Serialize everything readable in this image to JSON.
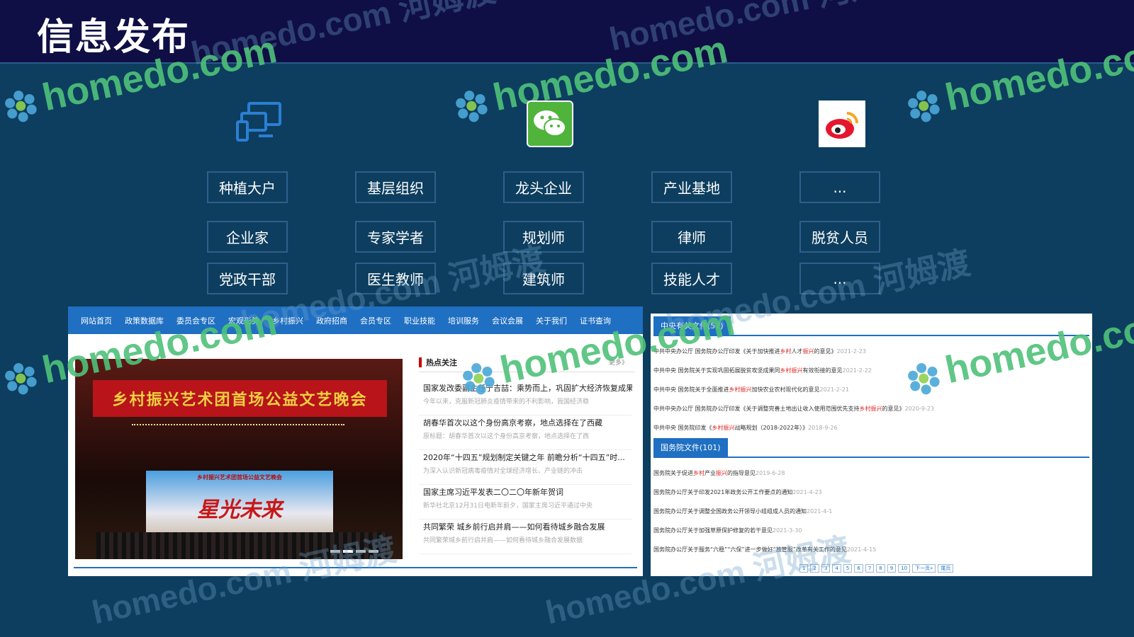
{
  "page_title": "信息发布",
  "watermark": {
    "brand": "homedo.com",
    "cn": "河姆渡"
  },
  "channels": [
    {
      "icon": "devices-icon"
    },
    {
      "icon": "wechat-icon"
    },
    {
      "icon": "weibo-icon"
    }
  ],
  "groups": [
    [
      "种植大户",
      "基层组织",
      "龙头企业",
      "产业基地",
      "..."
    ],
    [
      "企业家",
      "专家学者",
      "规划师",
      "律师",
      "脱贫人员"
    ],
    [
      "党政干部",
      "医生教师",
      "建筑师",
      "技能人才",
      "..."
    ]
  ],
  "left_site": {
    "nav": [
      "网站首页",
      "政策数据库",
      "委员会专区",
      "宏观形势",
      "乡村振兴",
      "政府招商",
      "会员专区",
      "职业技能",
      "培训服务",
      "会议会展",
      "关于我们",
      "证书查询"
    ],
    "banner_text": "乡村振兴艺术团首场公益文艺晚会",
    "screen_title": "乡村振兴艺术团首场公益文艺晚会",
    "screen_art": "星光未来",
    "hot_label": "热点关注",
    "hot_more": "更多》",
    "hot_items": [
      {
        "title": "国家发改委副主任宁吉喆：乘势而上，巩固扩大经济恢复成果",
        "summary": "今年以来，克服新冠肺炎疫情带来的不利影响，我国经济稳"
      },
      {
        "title": "胡春华首次以这个身份高京考察，地点选择在了西藏",
        "summary": "原标题：胡春华首次以这个身份高京考察，地点选择在了西"
      },
      {
        "title": "2020年“十四五”规划制定关键之年 前瞻分析“十四五”时...",
        "summary": "为深入认识新冠病毒疫情对全球经济增长、产业链的冲击"
      },
      {
        "title": "国家主席习近平发表二〇二〇年新年贺词",
        "summary": "新华社北京12月31日电新年前夕，国家主席习近平通过中央"
      },
      {
        "title": "共同繁荣 城乡前行启并肩——如何看待城乡融合发展",
        "summary": "共同繁荣城乡前行启并肩——如何看待城乡融合发展数据"
      }
    ]
  },
  "right_site": {
    "tab1": "中央有关文件(57)",
    "central_docs": [
      {
        "a": "中共中央办公厅 国务院办公厅印发《关于加快推进",
        "hl": "乡村",
        "b": "人才",
        "hl2": "振兴",
        "c": "的意见》",
        "date": "2021-2-23"
      },
      {
        "a": "中共中央 国务院关于实现巩固拓展脱贫攻坚成果同",
        "hl": "乡村振兴",
        "b": "有效衔接的意见",
        "hl2": "",
        "c": "",
        "date": "2021-2-22"
      },
      {
        "a": "中共中央 国务院关于全面推进",
        "hl": "乡村振兴",
        "b": "加快农业农村现代化的意见",
        "hl2": "",
        "c": "",
        "date": "2021-2-21"
      },
      {
        "a": "中共中央办公厅 国务院办公厅印发《关于调整完善土地出让收入使用范围优先支持",
        "hl": "乡村振兴",
        "b": "的意见》",
        "hl2": "",
        "c": "",
        "date": "2020-9-23"
      },
      {
        "a": "中共中央 国务院印发《",
        "hl": "乡村振兴",
        "b": "战略规划（2018-2022年）》",
        "hl2": "",
        "c": "",
        "date": "2018-9-26"
      }
    ],
    "tab2": "国务院文件(101)",
    "state_docs": [
      {
        "a": "国务院关于促进",
        "hl": "乡村",
        "b": "产业",
        "hl2": "振兴",
        "c": "的指导意见",
        "date": "2019-6-28"
      },
      {
        "a": "国务院办公厅关于印发2021年政务公开工作要点的通知",
        "hl": "",
        "b": "",
        "hl2": "",
        "c": "",
        "date": "2021-4-23"
      },
      {
        "a": "国务院办公厅关于调整全国政务公开领导小组组成人员的通知",
        "hl": "",
        "b": "",
        "hl2": "",
        "c": "",
        "date": "2021-4-1"
      },
      {
        "a": "国务院办公厅关于加强草原保护修复的若干意见",
        "hl": "",
        "b": "",
        "hl2": "",
        "c": "",
        "date": "2021-3-30"
      },
      {
        "a": "国务院办公厅关于服务“六稳”“六保”进一步做好“放管服”改革有关工作的意见",
        "hl": "",
        "b": "",
        "hl2": "",
        "c": "",
        "date": "2021-4-15"
      }
    ],
    "pager": [
      "1",
      "2",
      "3",
      "4",
      "5",
      "6",
      "7",
      "8",
      "9",
      "10",
      "下一页»",
      "尾页"
    ]
  }
}
